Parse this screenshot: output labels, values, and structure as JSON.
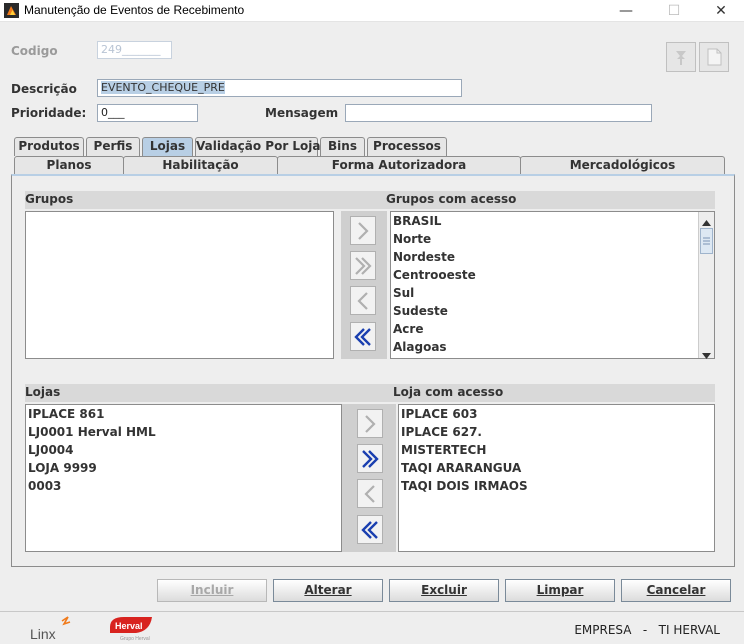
{
  "window": {
    "title": "Manutenção de Eventos de Recebimento",
    "minimize": "—",
    "maximize": "☐",
    "close": "✕"
  },
  "form": {
    "codigo_label": "Codigo",
    "codigo_value": "249_______",
    "descricao_label": "Descrição",
    "descricao_value": "EVENTO_CHEQUE_PRE",
    "prioridade_label": "Prioridade:",
    "prioridade_value": "0___",
    "mensagem_label": "Mensagem",
    "mensagem_value": ""
  },
  "tabs_row1": [
    "Produtos",
    "Perfis",
    "Lojas",
    "Validação Por Loja",
    "Bins",
    "Processos"
  ],
  "tabs_row2": [
    "Planos",
    "Habilitação",
    "Forma Autorizadora",
    "Mercadológicos"
  ],
  "active_tab": "Lojas",
  "grupos": {
    "header": "Grupos",
    "items": []
  },
  "grupos_com_acesso": {
    "header": "Grupos com acesso",
    "items": [
      "BRASIL",
      "Norte",
      "Nordeste",
      "Centrooeste",
      "Sul",
      "Sudeste",
      "Acre",
      "Alagoas"
    ]
  },
  "lojas": {
    "header": "Lojas",
    "items": [
      "IPLACE 861",
      "LJ0001 Herval HML",
      "LJ0004",
      "LOJA 9999",
      "0003"
    ]
  },
  "loja_com_acesso": {
    "header": "Loja com acesso",
    "items": [
      "IPLACE 603",
      "IPLACE 627.",
      "MISTERTECH",
      "TAQI ARARANGUA",
      "TAQI DOIS IRMAOS"
    ]
  },
  "buttons": {
    "incluir": "Incluir",
    "alterar": "Alterar",
    "excluir": "Excluir",
    "limpar": "Limpar",
    "cancelar": "Cancelar"
  },
  "footer": {
    "linx_logo": "Linx",
    "herval_logo": "Herval",
    "herval_sub": "Grupo Herval",
    "status": "EMPRESA   -   TI HERVAL"
  },
  "colors": {
    "accent": "#b8cfe5",
    "arrow_active": "#1a3fb0",
    "arrow_disabled": "#b0b0b0"
  }
}
